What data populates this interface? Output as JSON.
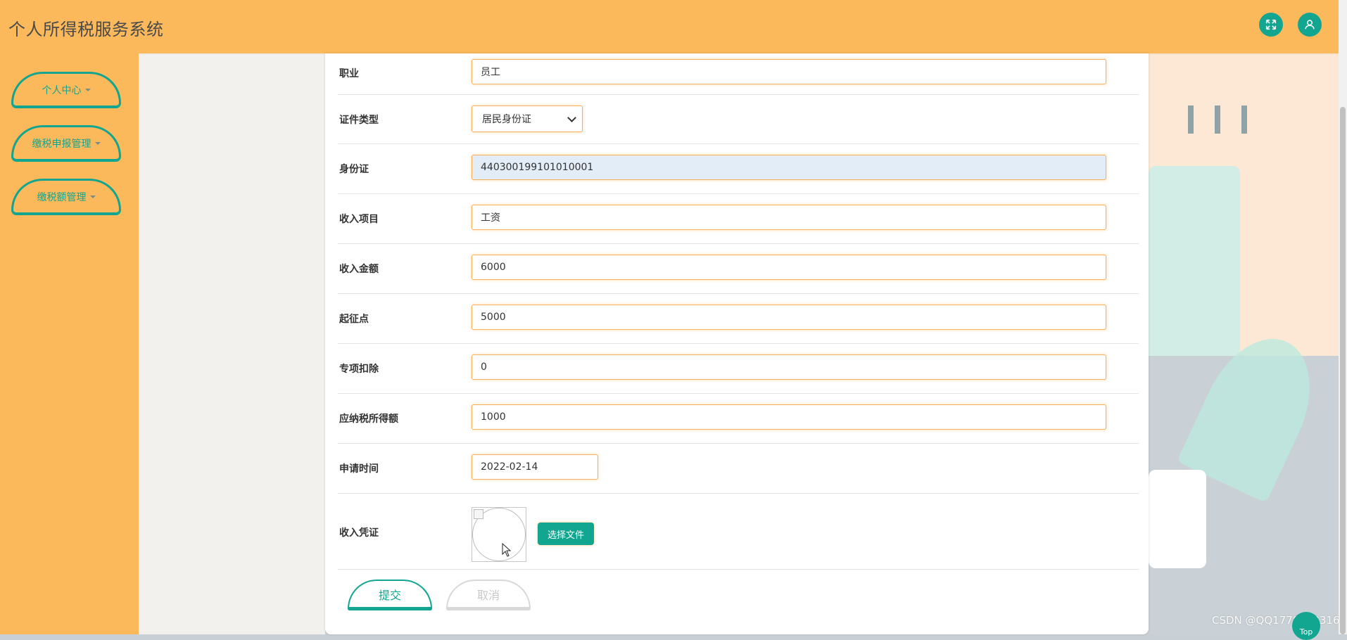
{
  "header": {
    "app_title": "个人所得税服务系统",
    "fullscreen_icon": "expand-icon",
    "user_icon": "user-icon"
  },
  "sidebar": {
    "items": [
      {
        "label": "个人中心"
      },
      {
        "label": "缴税申报管理"
      },
      {
        "label": "缴税额管理"
      }
    ]
  },
  "form": {
    "occupation": {
      "label": "职业",
      "value": "员工"
    },
    "id_type": {
      "label": "证件类型",
      "value": "居民身份证"
    },
    "id_number": {
      "label": "身份证",
      "value": "440300199101010001"
    },
    "income_item": {
      "label": "收入项目",
      "value": "工资"
    },
    "income_amount": {
      "label": "收入金额",
      "value": "6000"
    },
    "threshold": {
      "label": "起征点",
      "value": "5000"
    },
    "special_deduction": {
      "label": "专项扣除",
      "value": "0"
    },
    "taxable_income": {
      "label": "应纳税所得额",
      "value": "1000"
    },
    "apply_time": {
      "label": "申请时间",
      "value": "2022-02-14"
    },
    "proof": {
      "label": "收入凭证",
      "choose_file_label": "选择文件"
    },
    "submit_label": "提交",
    "cancel_label": "取消"
  },
  "footer": {
    "watermark": "CSDN @QQ1778253316",
    "top_label": "Top"
  },
  "colors": {
    "header_bg": "#fbb95b",
    "accent": "#12a58f"
  }
}
